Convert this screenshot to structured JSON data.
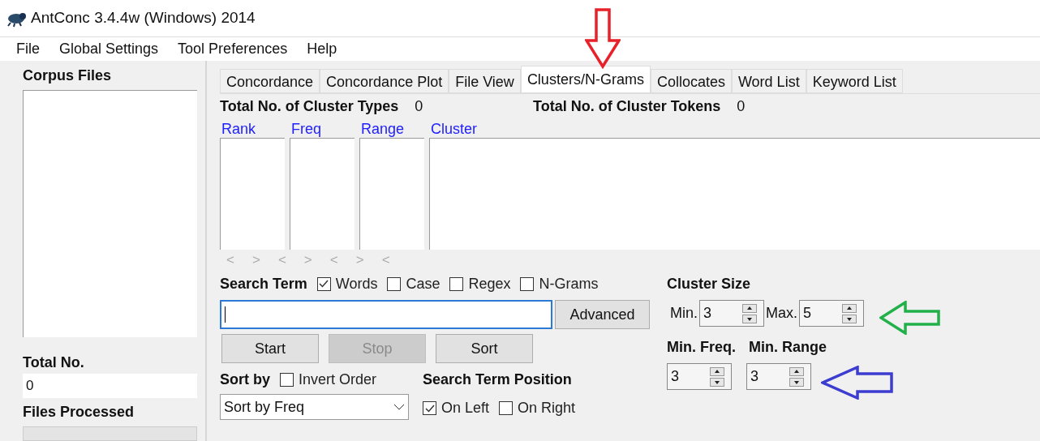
{
  "window": {
    "title": "AntConc 3.4.4w (Windows) 2014"
  },
  "menu": [
    "File",
    "Global Settings",
    "Tool Preferences",
    "Help"
  ],
  "sidebar": {
    "title": "Corpus Files",
    "total_label": "Total No.",
    "total_value": "0",
    "processed_label": "Files Processed",
    "progress": {
      "level": 0
    }
  },
  "tabs": [
    {
      "label": "Concordance",
      "selected": false
    },
    {
      "label": "Concordance Plot",
      "selected": false
    },
    {
      "label": "File View",
      "selected": false
    },
    {
      "label": "Clusters/N-Grams",
      "selected": true
    },
    {
      "label": "Collocates",
      "selected": false
    },
    {
      "label": "Word List",
      "selected": false
    },
    {
      "label": "Keyword List",
      "selected": false
    }
  ],
  "stats": [
    {
      "label": "Total No. of Cluster Types",
      "value": "0"
    },
    {
      "label": "Total No. of Cluster Tokens",
      "value": "0"
    }
  ],
  "table": {
    "columns": [
      "Rank",
      "Freq",
      "Range",
      "Cluster"
    ]
  },
  "scroll_arrows": [
    "<",
    ">",
    "<",
    ">",
    "<",
    ">",
    "<"
  ],
  "search": {
    "label": "Search Term",
    "options": [
      {
        "label": "Words",
        "checked": true
      },
      {
        "label": "Case",
        "checked": false
      },
      {
        "label": "Regex",
        "checked": false
      },
      {
        "label": "N-Grams",
        "checked": false
      }
    ],
    "advanced": "Advanced"
  },
  "buttons": [
    {
      "label": "Start",
      "disabled": false
    },
    {
      "label": "Stop",
      "disabled": true
    },
    {
      "label": "Sort",
      "disabled": false
    }
  ],
  "sort": {
    "label": "Sort by",
    "invert": {
      "label": "Invert Order",
      "checked": false
    },
    "value": "Sort by Freq"
  },
  "position": {
    "label": "Search Term Position",
    "options": [
      {
        "label": "On Left",
        "checked": true
      },
      {
        "label": "On Right",
        "checked": false
      }
    ]
  },
  "cluster_size": {
    "label": "Cluster Size",
    "min_label": "Min.",
    "min": "3",
    "max_label": "Max.",
    "max": "5"
  },
  "limits": {
    "freq_label": "Min. Freq.",
    "freq": "3",
    "range_label": "Min. Range",
    "range": "3"
  }
}
